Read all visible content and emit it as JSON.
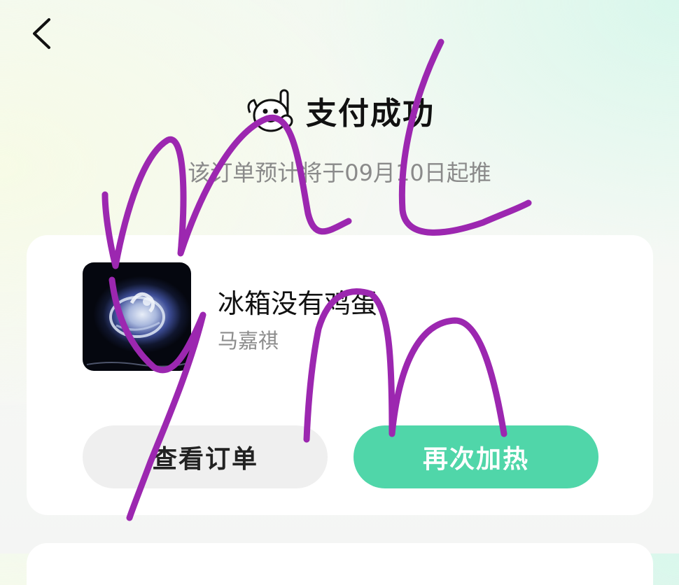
{
  "header": {
    "back_icon": "chevron-left-icon"
  },
  "status": {
    "mascot_icon": "cheering-mascot-icon",
    "title": "支付成功",
    "subtitle": "该订单预计将于09月10日起推"
  },
  "order": {
    "cover_icon": "album-cover-image",
    "song_title": "冰箱没有鸡蛋",
    "artist": "马嘉祺",
    "buttons": {
      "view_order": "查看订单",
      "reheat": "再次加热"
    }
  },
  "colors": {
    "accent": "#50d6a9",
    "scribble": "#9c27b0"
  }
}
